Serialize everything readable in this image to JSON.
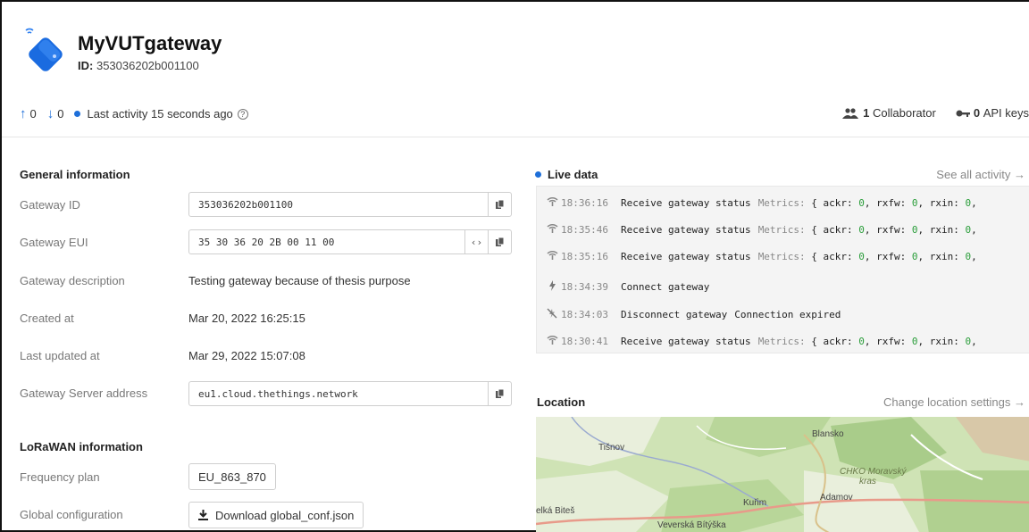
{
  "gateway": {
    "name": "MyVUTgateway",
    "id_label": "ID:",
    "id_value": "353036202b001100"
  },
  "stats": {
    "uplink_count": "0",
    "downlink_count": "0",
    "last_activity": "Last activity 15 seconds ago",
    "collaborators_count": "1",
    "collaborators_label": "Collaborator",
    "api_keys_count": "0",
    "api_keys_label": "API keys"
  },
  "general": {
    "heading": "General information",
    "gateway_id_label": "Gateway ID",
    "gateway_id_value": "353036202b001100",
    "gateway_eui_label": "Gateway EUI",
    "gateway_eui_value": "35 30 36 20 2B 00 11 00",
    "description_label": "Gateway description",
    "description_value": "Testing gateway because of thesis purpose",
    "created_label": "Created at",
    "created_value": "Mar 20, 2022 16:25:15",
    "updated_label": "Last updated at",
    "updated_value": "Mar 29, 2022 15:07:08",
    "server_label": "Gateway Server address",
    "server_value": "eu1.cloud.thethings.network"
  },
  "lorawan": {
    "heading": "LoRaWAN information",
    "freq_label": "Frequency plan",
    "freq_value": "EU_863_870",
    "global_conf_label": "Global configuration",
    "download_button": "Download global_conf.json"
  },
  "live": {
    "heading": "Live data",
    "see_all": "See all activity →",
    "events": [
      {
        "icon": "wifi-icon",
        "time": "18:36:16",
        "message": "Receive gateway status",
        "detail_key": "Metrics:"
      },
      {
        "icon": "wifi-icon",
        "time": "18:35:46",
        "message": "Receive gateway status",
        "detail_key": "Metrics:"
      },
      {
        "icon": "wifi-icon",
        "time": "18:35:16",
        "message": "Receive gateway status",
        "detail_key": "Metrics:"
      },
      {
        "icon": "bolt-icon",
        "time": "18:34:39",
        "message": "Connect gateway",
        "detail_key": ""
      },
      {
        "icon": "bolt-off-icon",
        "time": "18:34:03",
        "message": "Disconnect gateway",
        "detail_key": "Connection expired"
      },
      {
        "icon": "wifi-icon",
        "time": "18:30:41",
        "message": "Receive gateway status",
        "detail_key": "Metrics:"
      }
    ],
    "metrics_text": {
      "open": "{",
      "ackr": "ackr:",
      "rxfw": "rxfw:",
      "rxin": "rxin:",
      "zero": "0"
    }
  },
  "location": {
    "heading": "Location",
    "change": "Change location settings →",
    "places": [
      "Blansko",
      "Tišnov",
      "CHKO Moravský",
      "kras",
      "Adamov",
      "Kuřim",
      "elká Biteš",
      "Veverská Bítýška"
    ]
  },
  "colors": {
    "accent": "#1e6fd9",
    "number": "#2a9d3a"
  }
}
